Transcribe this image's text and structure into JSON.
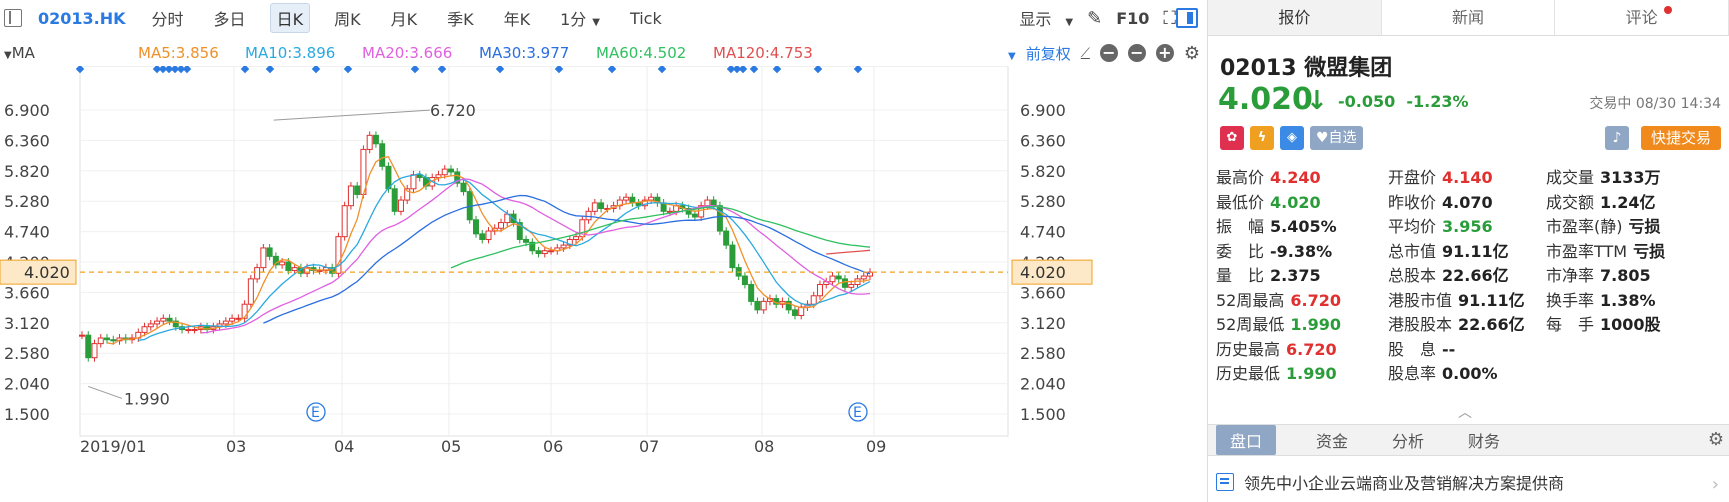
{
  "toolbar": {
    "code": "02013.HK",
    "periods": [
      "分时",
      "多日",
      "日K",
      "周K",
      "月K",
      "季K",
      "年K",
      "1分",
      "Tick"
    ],
    "active_period": "日K",
    "display_label": "显示",
    "f10_label": "F10"
  },
  "ma_row": {
    "label": "MA",
    "items": [
      {
        "text": "MA5:3.856",
        "color": "#f0902a"
      },
      {
        "text": "MA10:3.896",
        "color": "#2aa9e0"
      },
      {
        "text": "MA20:3.666",
        "color": "#e060e0"
      },
      {
        "text": "MA30:3.977",
        "color": "#2a6ee0"
      },
      {
        "text": "MA60:4.502",
        "color": "#30c060"
      },
      {
        "text": "MA120:4.753",
        "color": "#e05050"
      }
    ],
    "adjust_label": "前复权"
  },
  "colors": {
    "up": "#e03030",
    "down": "#2a9d3a",
    "accent": "#2a7ae2",
    "guide": "#f0a020"
  },
  "chart_data": {
    "type": "candlestick",
    "y_ticks": [
      "6.900",
      "6.360",
      "5.820",
      "5.280",
      "4.740",
      "4.200",
      "3.660",
      "3.120",
      "2.580",
      "2.040",
      "1.500"
    ],
    "x_ticks": [
      "2019/01",
      "03",
      "04",
      "05",
      "06",
      "07",
      "08",
      "09"
    ],
    "current_price_label": "4.020",
    "current_price": 4.02,
    "high_annotation": "6.720",
    "high_value": 6.72,
    "low_annotation": "1.990",
    "low_value": 1.99,
    "event_marker": "E",
    "ylim": [
      1.5,
      6.9
    ],
    "closes": [
      2.9,
      2.5,
      2.75,
      2.85,
      2.82,
      2.8,
      2.85,
      2.82,
      2.85,
      2.95,
      3.05,
      3.1,
      3.15,
      3.2,
      3.15,
      3.05,
      3.0,
      3.0,
      3.0,
      3.05,
      3.0,
      3.05,
      3.1,
      3.15,
      3.2,
      3.2,
      3.45,
      3.9,
      4.1,
      4.45,
      4.3,
      4.15,
      4.2,
      4.05,
      4.1,
      4.0,
      4.1,
      4.05,
      4.05,
      4.1,
      4.0,
      4.65,
      5.2,
      5.55,
      5.4,
      6.2,
      6.45,
      6.3,
      5.9,
      5.5,
      5.1,
      5.3,
      5.5,
      5.75,
      5.7,
      5.55,
      5.7,
      5.75,
      5.85,
      5.8,
      5.6,
      5.45,
      4.95,
      4.7,
      4.6,
      4.75,
      4.8,
      4.9,
      5.05,
      4.9,
      4.6,
      4.55,
      4.4,
      4.35,
      4.4,
      4.4,
      4.45,
      4.5,
      4.6,
      4.65,
      4.95,
      5.1,
      5.25,
      5.15,
      5.15,
      5.2,
      5.3,
      5.35,
      5.25,
      5.2,
      5.3,
      5.35,
      5.25,
      5.1,
      5.1,
      5.2,
      5.15,
      5.05,
      5.0,
      5.2,
      5.3,
      5.2,
      4.75,
      4.5,
      4.1,
      3.95,
      3.8,
      3.5,
      3.35,
      3.5,
      3.55,
      3.45,
      3.5,
      3.35,
      3.25,
      3.4,
      3.45,
      3.6,
      3.8,
      3.85,
      3.95,
      3.9,
      3.75,
      3.8,
      3.9,
      3.95,
      4.02
    ]
  },
  "panel": {
    "tabs": [
      "报价",
      "新闻",
      "评论"
    ],
    "name": "02013 微盟集团",
    "price": "4.020",
    "change": "-0.050",
    "change_pct": "-1.23%",
    "status": "交易中 08/30 14:34",
    "watch_label": "♥自选",
    "fast_trade_label": "快捷交易",
    "stats": [
      [
        {
          "k": "最高价",
          "v": "4.240",
          "c": "up"
        },
        {
          "k": "开盘价",
          "v": "4.140",
          "c": "up"
        },
        {
          "k": "成交量",
          "v": "3133万",
          "c": "nt"
        }
      ],
      [
        {
          "k": "最低价",
          "v": "4.020",
          "c": "dn"
        },
        {
          "k": "昨收价",
          "v": "4.070",
          "c": "nt"
        },
        {
          "k": "成交额",
          "v": "1.24亿",
          "c": "nt"
        }
      ],
      [
        {
          "k": "振　幅",
          "v": "5.405%",
          "c": "nt"
        },
        {
          "k": "平均价",
          "v": "3.956",
          "c": "dn"
        },
        {
          "k": "市盈率(静)",
          "v": "亏损",
          "c": "nt"
        }
      ],
      [
        {
          "k": "委　比",
          "v": "-9.38%",
          "c": "nt"
        },
        {
          "k": "总市值",
          "v": "91.11亿",
          "c": "nt"
        },
        {
          "k": "市盈率TTM",
          "v": "亏损",
          "c": "nt"
        }
      ],
      [
        {
          "k": "量　比",
          "v": "2.375",
          "c": "nt"
        },
        {
          "k": "总股本",
          "v": "22.66亿",
          "c": "nt"
        },
        {
          "k": "市净率",
          "v": "7.805",
          "c": "nt"
        }
      ],
      [
        {
          "k": "52周最高",
          "v": "6.720",
          "c": "up"
        },
        {
          "k": "港股市值",
          "v": "91.11亿",
          "c": "nt"
        },
        {
          "k": "换手率",
          "v": "1.38%",
          "c": "nt"
        }
      ],
      [
        {
          "k": "52周最低",
          "v": "1.990",
          "c": "dn"
        },
        {
          "k": "港股股本",
          "v": "22.66亿",
          "c": "nt"
        },
        {
          "k": "每　手",
          "v": "1000股",
          "c": "nt"
        }
      ],
      [
        {
          "k": "历史最高",
          "v": "6.720",
          "c": "up"
        },
        {
          "k": "股　息",
          "v": "--",
          "c": "nt"
        },
        {
          "k": "",
          "v": "",
          "c": "nt"
        }
      ],
      [
        {
          "k": "历史最低",
          "v": "1.990",
          "c": "dn"
        },
        {
          "k": "股息率",
          "v": "0.00%",
          "c": "nt"
        },
        {
          "k": "",
          "v": "",
          "c": "nt"
        }
      ]
    ],
    "bottom_tabs": [
      "盘口",
      "资金",
      "分析",
      "财务"
    ],
    "description": "领先中小企业云端商业及营销解决方案提供商"
  }
}
